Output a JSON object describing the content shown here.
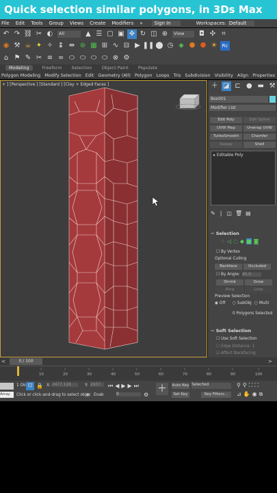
{
  "banner": {
    "title": "Quick selection similar polygons, in 3Ds Max"
  },
  "menu": {
    "items": [
      "File",
      "Edit",
      "Tools",
      "Group",
      "Views",
      "Create",
      "Modifiers"
    ],
    "more": "»",
    "sign_in": "Sign In",
    "workspaces_label": "Workspaces:",
    "workspace": "Default"
  },
  "toolbar": {
    "filter": "All",
    "view": "View"
  },
  "ribbon": {
    "tabs": [
      "Modeling",
      "Freeform",
      "Selection",
      "Object Paint",
      "Populate"
    ],
    "sub": [
      "Polygon Modeling",
      "Modify Selection",
      "Edit",
      "Geometry (All)",
      "Polygon",
      "Loops",
      "Tris",
      "Subdivision",
      "Visibility",
      "Align",
      "Properties"
    ]
  },
  "viewport": {
    "label": "+ ] [Perspective ] [Standard ] [Clay + Edged Faces ]"
  },
  "command_panel": {
    "object_name": "Box001",
    "modifier_list": "Modifier List",
    "modifier_buttons": [
      "Edit Poly",
      "Edit Spline",
      "UVW Map",
      "Unwrap UVW",
      "TurboSmooth",
      "Chamfer",
      "Sweep",
      "Shell"
    ],
    "stack_item": "Editable Poly"
  },
  "selection": {
    "header": "Selection",
    "by_vertex": "By Vertex",
    "optional_culling": "Optional Culling",
    "backface": "Backface",
    "occluded": "Occluded",
    "by_angle": "By Angle:",
    "angle_value": "45.0",
    "shrink": "Shrink",
    "grow": "Grow",
    "ring": "Ring",
    "loop": "Loop",
    "preview_selection": "Preview Selection",
    "off": "Off",
    "subobj": "SubObj",
    "multi": "Multi",
    "status": "0 Polygons Selected"
  },
  "soft_selection": {
    "header": "Soft Selection",
    "use": "Use Soft Selection",
    "edge_distance": "Edge Distance:",
    "edge_value": "1",
    "affect_backfacing": "Affect Backfacing"
  },
  "timeline": {
    "frame": "0 / 100",
    "ticks": [
      "10",
      "20",
      "30",
      "40",
      "50",
      "60",
      "70",
      "80",
      "90",
      "100"
    ]
  },
  "status": {
    "objects": "1 Ob",
    "hint": "Click or click-and-drag to select objec",
    "array": "Array",
    "x_label": "X:",
    "x_value": "2477.116",
    "y_label": "Y:",
    "y_value": "2637",
    "enable": "Enab",
    "frame_value": "0",
    "auto_key": "Auto Key",
    "set_key": "Set Key",
    "selected": "Selected",
    "key_filters": "Key Filters..."
  }
}
